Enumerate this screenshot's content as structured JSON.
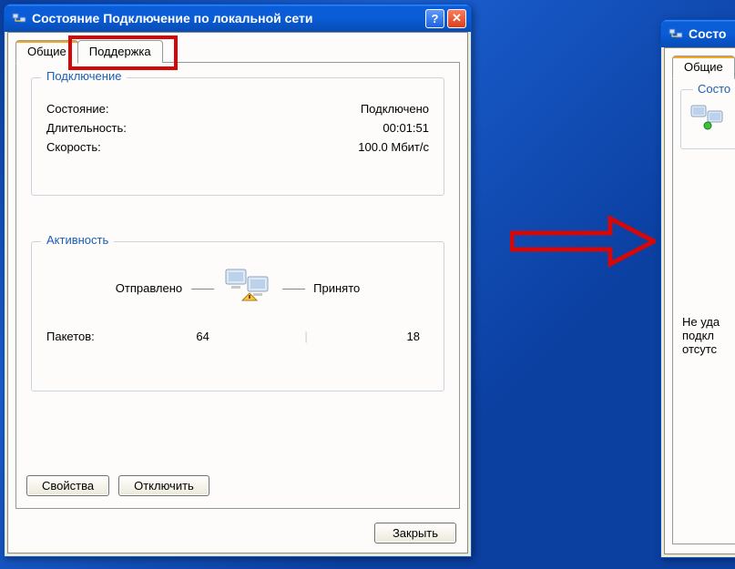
{
  "window1": {
    "title": "Состояние Подключение по локальной сети",
    "help_symbol": "?",
    "close_symbol": "✕",
    "tabs": {
      "general": "Общие",
      "support": "Поддержка"
    },
    "connection": {
      "legend": "Подключение",
      "status_label": "Состояние:",
      "status_value": "Подключено",
      "duration_label": "Длительность:",
      "duration_value": "00:01:51",
      "speed_label": "Скорость:",
      "speed_value": "100.0 Мбит/с"
    },
    "activity": {
      "legend": "Активность",
      "sent_label": "Отправлено",
      "recv_label": "Принято",
      "packets_label": "Пакетов:",
      "packets_sent": "64",
      "packets_recv": "18"
    },
    "buttons": {
      "properties": "Свойства",
      "disable": "Отключить",
      "close": "Закрыть"
    }
  },
  "window2": {
    "title_fragment": "Состо",
    "tabs": {
      "general": "Общие"
    },
    "group_legend_fragment": "Состо",
    "paragraph": "Не уда\nподкл\nотсутс"
  }
}
